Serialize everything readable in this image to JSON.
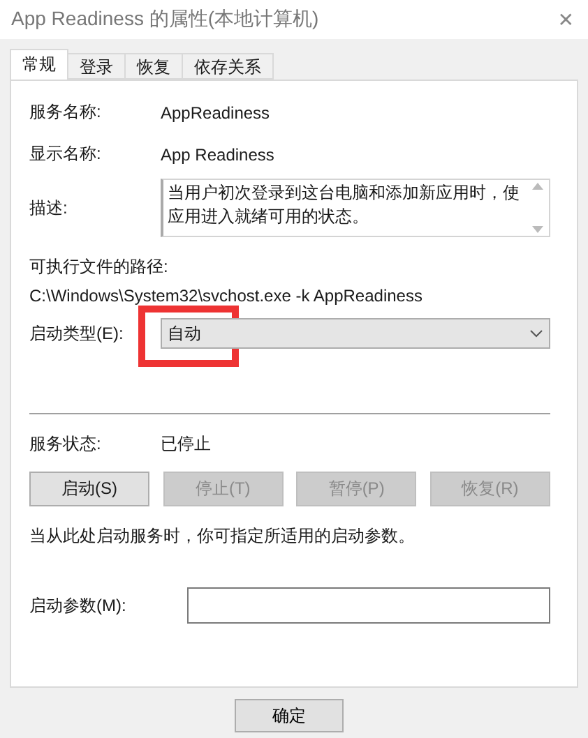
{
  "window": {
    "title": "App Readiness 的属性(本地计算机)",
    "close": "✕"
  },
  "tabs": [
    {
      "label": "常规",
      "selected": true
    },
    {
      "label": "登录",
      "selected": false
    },
    {
      "label": "恢复",
      "selected": false
    },
    {
      "label": "依存关系",
      "selected": false
    }
  ],
  "service_name": {
    "label": "服务名称:",
    "value": "AppReadiness"
  },
  "display_name": {
    "label": "显示名称:",
    "value": "App Readiness"
  },
  "description": {
    "label": "描述:",
    "value": "当用户初次登录到这台电脑和添加新应用时，使应用进入就绪可用的状态。"
  },
  "executable_path": {
    "label": "可执行文件的路径:",
    "value": "C:\\Windows\\System32\\svchost.exe -k AppReadiness"
  },
  "startup_type": {
    "label": "启动类型(E):",
    "value": "自动",
    "highlighted": true
  },
  "service_status": {
    "label": "服务状态:",
    "value": "已停止"
  },
  "service_buttons": [
    {
      "label": "启动(S)",
      "disabled": false
    },
    {
      "label": "停止(T)",
      "disabled": true
    },
    {
      "label": "暂停(P)",
      "disabled": true
    },
    {
      "label": "恢复(R)",
      "disabled": true
    }
  ],
  "hint": "当从此处启动服务时，你可指定所适用的启动参数。",
  "start_parameters": {
    "label": "启动参数(M):"
  },
  "dialog_buttons": [
    "确定"
  ]
}
